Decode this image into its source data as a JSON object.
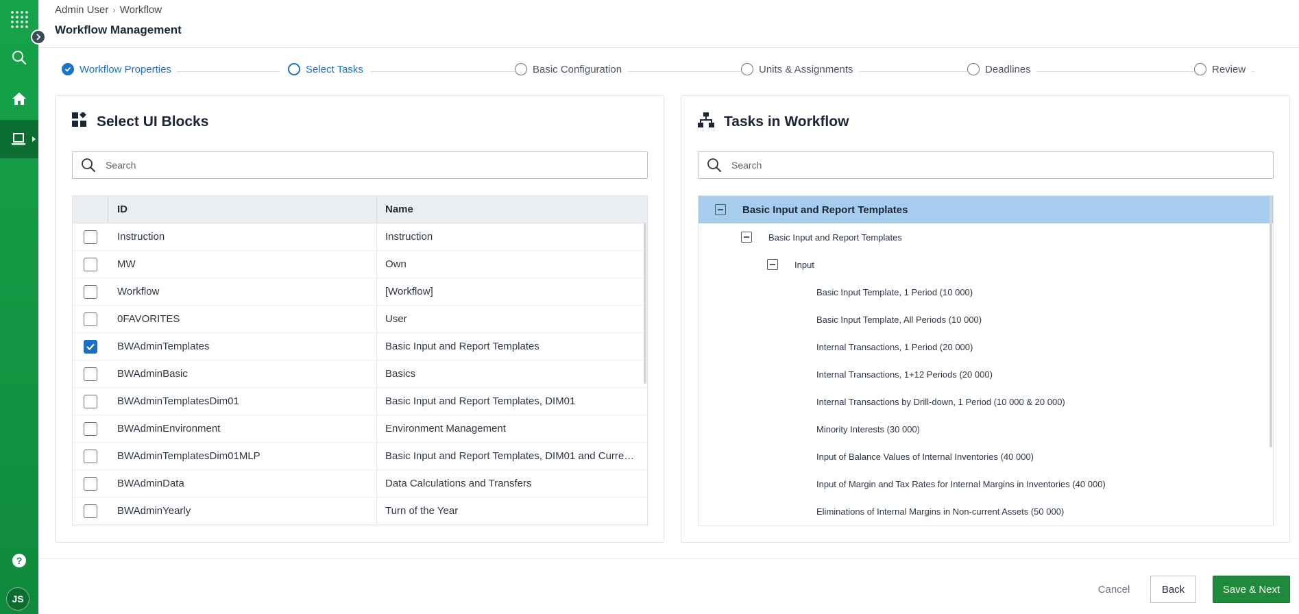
{
  "breadcrumb": {
    "root": "Admin User",
    "separator": "›",
    "current": "Workflow"
  },
  "page_title": "Workflow Management",
  "sidebar": {
    "items": [
      {
        "icon": "apps-grid-icon"
      },
      {
        "icon": "search-icon"
      },
      {
        "icon": "home-icon"
      },
      {
        "icon": "laptop-icon",
        "active": true
      },
      {
        "icon": "help-icon"
      }
    ],
    "avatar": "JS",
    "accent": "#16a34a"
  },
  "stepper": {
    "steps": [
      {
        "label": "Workflow Properties",
        "state": "done"
      },
      {
        "label": "Select Tasks",
        "state": "current"
      },
      {
        "label": "Basic Configuration",
        "state": "todo"
      },
      {
        "label": "Units & Assignments",
        "state": "todo"
      },
      {
        "label": "Deadlines",
        "state": "todo"
      },
      {
        "label": "Review",
        "state": "todo"
      }
    ]
  },
  "left_panel": {
    "title": "Select UI Blocks",
    "icon": "blocks-icon",
    "search_placeholder": "Search",
    "columns": {
      "id": "ID",
      "name": "Name"
    },
    "rows": [
      {
        "id": "Instruction",
        "name": "Instruction",
        "checked": false
      },
      {
        "id": "MW",
        "name": "Own",
        "checked": false
      },
      {
        "id": "Workflow",
        "name": "[Workflow]",
        "checked": false
      },
      {
        "id": "0FAVORITES",
        "name": "User",
        "checked": false
      },
      {
        "id": "BWAdminTemplates",
        "name": "Basic Input and Report Templates",
        "checked": true
      },
      {
        "id": "BWAdminBasic",
        "name": "Basics",
        "checked": false
      },
      {
        "id": "BWAdminTemplatesDim01",
        "name": "Basic Input and Report Templates, DIM01",
        "checked": false
      },
      {
        "id": "BWAdminEnvironment",
        "name": "Environment Management",
        "checked": false
      },
      {
        "id": "BWAdminTemplatesDim01MLP",
        "name": "Basic Input and Report Templates, DIM01 and Currenc...",
        "checked": false
      },
      {
        "id": "BWAdminData",
        "name": "Data Calculations and Transfers",
        "checked": false
      },
      {
        "id": "BWAdminYearly",
        "name": "Turn of the Year",
        "checked": false
      }
    ]
  },
  "right_panel": {
    "title": "Tasks in Workflow",
    "icon": "hierarchy-icon",
    "search_placeholder": "Search",
    "tree": [
      {
        "label": "Basic Input and Report Templates",
        "level": 0,
        "toggle": true,
        "selected": true
      },
      {
        "label": "Basic Input and Report Templates",
        "level": 1,
        "toggle": true
      },
      {
        "label": "Input",
        "level": 2,
        "toggle": true
      },
      {
        "label": "Basic Input Template, 1 Period (10 000)",
        "level": 3
      },
      {
        "label": "Basic Input Template, All Periods (10 000)",
        "level": 3
      },
      {
        "label": "Internal Transactions, 1 Period (20 000)",
        "level": 3
      },
      {
        "label": "Internal Transactions, 1+12 Periods (20 000)",
        "level": 3
      },
      {
        "label": "Internal Transactions by Drill-down, 1 Period (10 000 & 20 000)",
        "level": 3
      },
      {
        "label": "Minority Interests (30 000)",
        "level": 3
      },
      {
        "label": "Input of Balance Values of Internal Inventories (40 000)",
        "level": 3
      },
      {
        "label": "Input of Margin and Tax Rates for Internal Margins in Inventories (40 000)",
        "level": 3
      },
      {
        "label": "Eliminations of Internal Margins in Non-current Assets (50 000)",
        "level": 3
      }
    ]
  },
  "footer": {
    "cancel": "Cancel",
    "back": "Back",
    "next": "Save & Next",
    "primary_color": "#1f8a3a"
  }
}
